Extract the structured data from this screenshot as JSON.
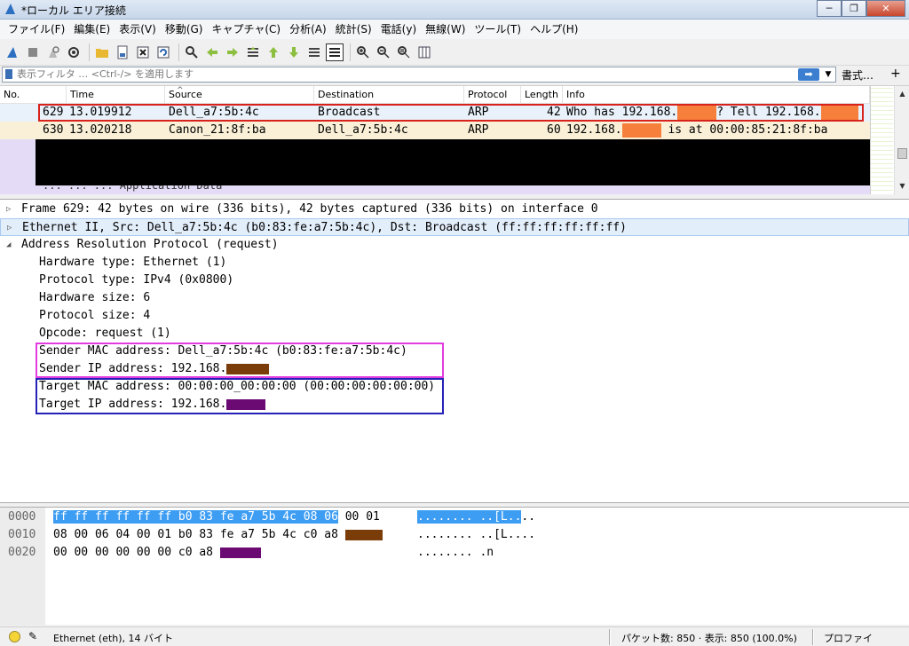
{
  "window": {
    "title": "*ローカル エリア接続",
    "min": "─",
    "max": "❐",
    "close": "✕"
  },
  "menu": [
    "ファイル(F)",
    "編集(E)",
    "表示(V)",
    "移動(G)",
    "キャプチャ(C)",
    "分析(A)",
    "統計(S)",
    "電話(y)",
    "無線(W)",
    "ツール(T)",
    "ヘルプ(H)"
  ],
  "filter": {
    "placeholder": "表示フィルタ … <Ctrl-/> を適用します",
    "apply_icon": "arrow-right-icon",
    "format_label": "書式…",
    "plus": "+"
  },
  "packet_list": {
    "columns": [
      "No.",
      "Time",
      "Source",
      "Destination",
      "Protocol",
      "Length",
      "Info"
    ],
    "rows": [
      {
        "no": "629",
        "time": "13.019912",
        "source": "Dell_a7:5b:4c",
        "destination": "Broadcast",
        "protocol": "ARP",
        "length": "42",
        "info_a": "Who has 192.168.",
        "info_b": "? Tell 192.168."
      },
      {
        "no": "630",
        "time": "13.020218",
        "source": "Canon_21:8f:ba",
        "destination": "Dell_a7:5b:4c",
        "protocol": "ARP",
        "length": "60",
        "info_a": "192.168.",
        "info_b": " is at 00:00:85:21:8f:ba"
      }
    ],
    "partial_row": "... ... ...   Application Data"
  },
  "details": {
    "frame": "Frame 629: 42 bytes on wire (336 bits), 42 bytes captured (336 bits) on interface 0",
    "ethernet": "Ethernet II, Src: Dell_a7:5b:4c (b0:83:fe:a7:5b:4c), Dst: Broadcast (ff:ff:ff:ff:ff:ff)",
    "arp": "Address Resolution Protocol (request)",
    "fields": [
      "Hardware type: Ethernet (1)",
      "Protocol type: IPv4 (0x0800)",
      "Hardware size: 6",
      "Protocol size: 4",
      "Opcode: request (1)",
      "Sender MAC address: Dell_a7:5b:4c (b0:83:fe:a7:5b:4c)",
      "Sender IP address: 192.168.",
      "Target MAC address: 00:00:00_00:00:00 (00:00:00:00:00:00)",
      "Target IP address: 192.168."
    ]
  },
  "bytes": [
    {
      "offset": "0000",
      "hex_sel": "ff ff ff ff ff ff b0 83  fe a7 5b 4c 08 06",
      "hex_rest": " 00 01",
      "ascii_sel": "........ ..[L..",
      "ascii_rest": ".."
    },
    {
      "offset": "0010",
      "hex_sel": "",
      "hex_rest": "08 00 06 04 00 01 b0 83  fe a7 5b 4c c0 a8",
      "ascii_sel": "",
      "ascii_rest": "........ ..[L...."
    },
    {
      "offset": "0020",
      "hex_sel": "",
      "hex_rest": "00 00 00 00 00 00 c0 a8",
      "ascii_sel": "",
      "ascii_rest": "........ .n"
    }
  ],
  "status": {
    "protocol": "Ethernet (eth), 14 バイト",
    "packets": "パケット数: 850 · 表示: 850 (100.0%)",
    "profile": "プロファイル:Default"
  },
  "colors": {
    "highlight_red": "#d9221c",
    "sender_box": "#e23be0",
    "target_box": "#2421b6",
    "selected_hex": "#3d9df3",
    "redact_orange": "#f67f3b",
    "redact_brown": "#7a3c08",
    "redact_purple": "#6a0a72"
  }
}
